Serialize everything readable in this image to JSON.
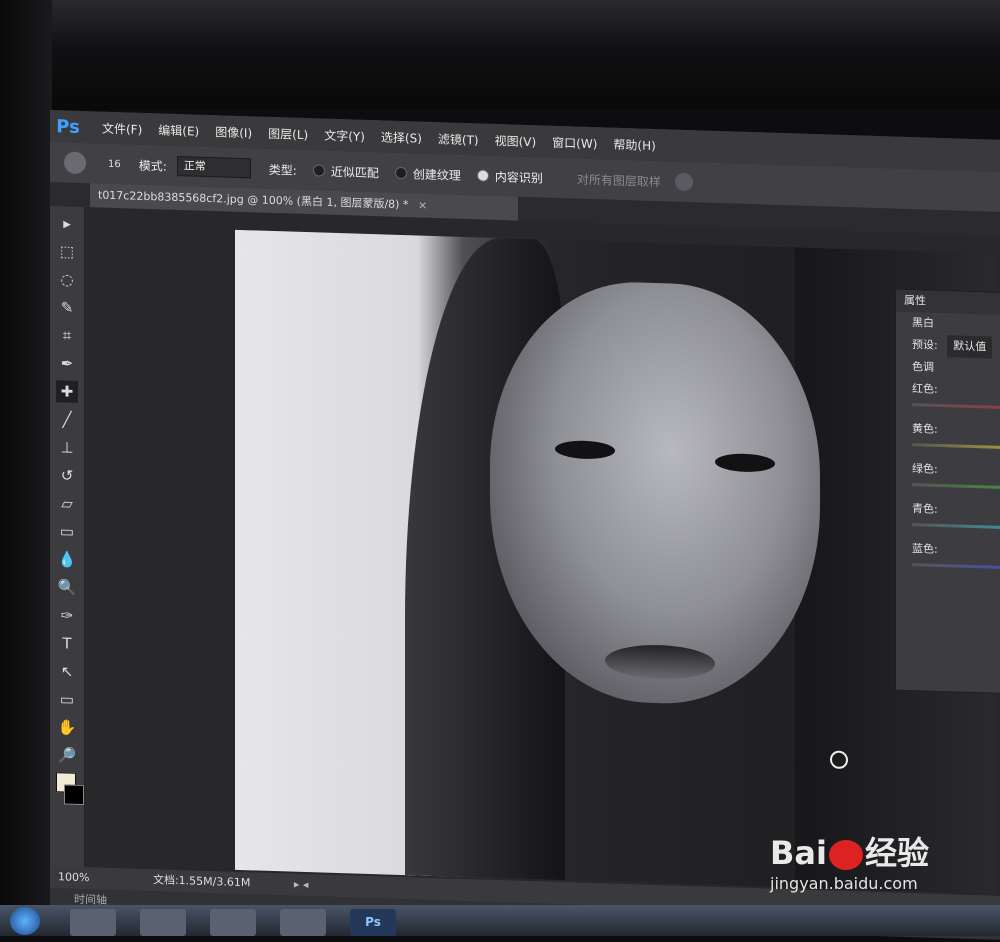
{
  "menubar": {
    "logo": "Ps",
    "items": [
      "文件(F)",
      "编辑(E)",
      "图像(I)",
      "图层(L)",
      "文字(Y)",
      "选择(S)",
      "滤镜(T)",
      "视图(V)",
      "窗口(W)",
      "帮助(H)"
    ]
  },
  "options": {
    "brush_size": "16",
    "mode_label": "模式:",
    "mode_value": "正常",
    "type_label": "类型:",
    "type_option1": "近似匹配",
    "type_option2": "创建纹理",
    "type_option3": "内容识别",
    "selected_type": "内容识别",
    "sample_all": "对所有图层取样"
  },
  "document": {
    "tab_title": "t017c22bb8385568cf2.jpg @ 100% (黑白 1, 图层蒙版/8) *",
    "close": "×"
  },
  "tools": [
    "move-icon",
    "marquee-icon",
    "lasso-icon",
    "quick-select-icon",
    "crop-icon",
    "eyedropper-icon",
    "healing-brush-icon",
    "brush-icon",
    "stamp-icon",
    "history-brush-icon",
    "eraser-icon",
    "gradient-icon",
    "blur-icon",
    "dodge-icon",
    "pen-icon",
    "type-icon",
    "path-select-icon",
    "shape-icon",
    "hand-icon",
    "zoom-icon"
  ],
  "tool_glyphs": [
    "▸",
    "⬚",
    "◌",
    "✎",
    "⌗",
    "✒",
    "✚",
    "╱",
    "⊥",
    "↺",
    "▱",
    "▭",
    "💧",
    "🔍",
    "✑",
    "T",
    "↖",
    "▭",
    "✋",
    "🔎"
  ],
  "colors": {
    "foreground": "#f2ecd6",
    "background": "#000000",
    "ps_blue": "#3fa2ff"
  },
  "status": {
    "zoom": "100%",
    "doc_info": "文档:1.55M/3.61M",
    "arrow": "▸ ◂"
  },
  "timeline": {
    "label": "时间轴"
  },
  "properties": {
    "header": "属性",
    "adjustment": "黑白",
    "preset_label": "预设:",
    "preset_value": "默认值",
    "tint_label": "色调",
    "sliders": [
      "红色:",
      "黄色:",
      "绿色:",
      "青色:",
      "蓝色:"
    ]
  },
  "taskbar": {
    "ps_label": "Ps"
  },
  "watermark": {
    "logo_left": "Bai",
    "logo_right": "经验",
    "url": "jingyan.baidu.com"
  }
}
